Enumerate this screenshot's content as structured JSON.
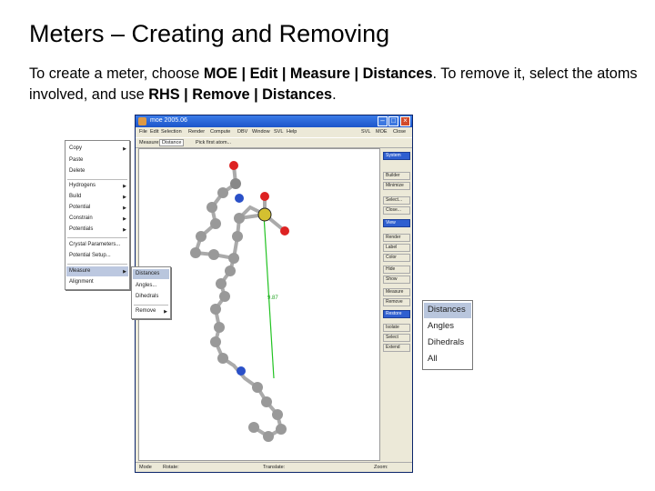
{
  "slide": {
    "title": "Meters – Creating and Removing",
    "intro_1": "To create a meter, choose ",
    "intro_path_create": "MOE | Edit | Measure | Distances",
    "intro_2": ". To remove it, select the atoms involved, and use ",
    "intro_path_remove": "RHS | Remove | Distances",
    "intro_3": "."
  },
  "window": {
    "title": "moe 2005.06",
    "menubar": [
      "File",
      "Edit",
      "Selection",
      "Render",
      "Compute",
      "DBV",
      "Window",
      "SVL",
      "Help"
    ],
    "menubar_right": [
      "SVL",
      "MOE",
      "Close"
    ],
    "toolbar": {
      "measure_label": "Measure:",
      "measure_value": "Distance",
      "pick_label": "Pick first atom..."
    },
    "right_panel": [
      "System",
      "Builder",
      "Minimize",
      "Select...",
      "Close...",
      "View",
      "Render",
      "Label",
      "Color",
      "Hide",
      "Show",
      "Measure",
      "Remove",
      "Restore",
      "Isolate",
      "Select",
      "Extend"
    ],
    "meter_value": "9.87",
    "statusbar": {
      "mode": "Mode",
      "rotate": "Rotate:",
      "translate": "Translate:",
      "zoom": "Zoom:"
    }
  },
  "edit_menu": [
    "Copy",
    "Paste",
    "Delete",
    "Hydrogens",
    "Build",
    "Potential",
    "Constrain",
    "Potentials",
    "Crystal Parameters...",
    "Potential Setup...",
    "Measure",
    "Alignment"
  ],
  "measure_submenu": [
    "Distances",
    "Angles...",
    "Dihedrals",
    "Remove"
  ],
  "remove_submenu": [
    "Distances",
    "Angles",
    "Dihedrals",
    "All"
  ],
  "colors": {
    "title_bar": "#1d55c9",
    "selection": "#2f5fd0",
    "meter_line": "#22c322",
    "menu_highlight": "#bcc8e0"
  }
}
